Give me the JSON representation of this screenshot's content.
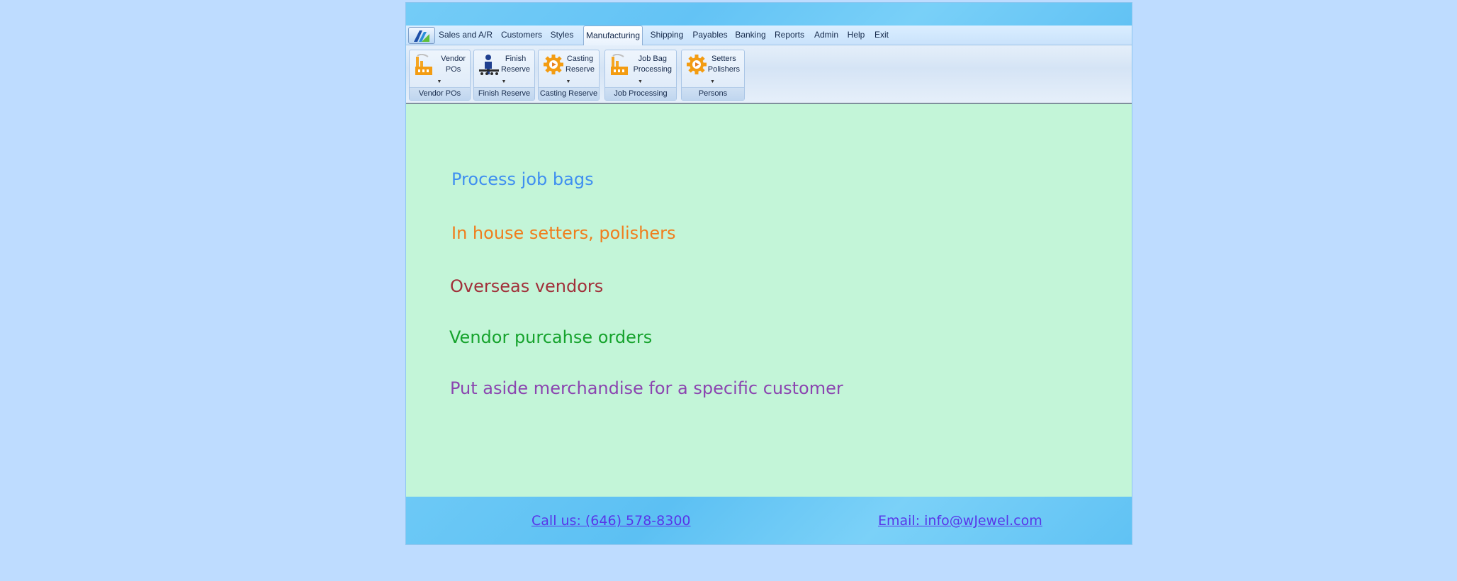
{
  "tabs": [
    {
      "label": "Sales and A/R"
    },
    {
      "label": "Customers"
    },
    {
      "label": "Styles"
    },
    {
      "label": "Manufacturing",
      "active": true
    },
    {
      "label": "Shipping"
    },
    {
      "label": "Payables"
    },
    {
      "label": "Banking"
    },
    {
      "label": "Reports"
    },
    {
      "label": "Admin"
    },
    {
      "label": "Help"
    },
    {
      "label": "Exit"
    }
  ],
  "ribbon": {
    "groups": [
      {
        "button_line1": "Vendor",
        "button_line2": "POs",
        "caption": "Vendor POs",
        "icon": "factory-icon"
      },
      {
        "button_line1": "Finish",
        "button_line2": "Reserve",
        "caption": "Finish Reserve",
        "icon": "worker-conveyor-icon"
      },
      {
        "button_line1": "Casting",
        "button_line2": "Reserve",
        "caption": "Casting Reserve",
        "icon": "gear-icon"
      },
      {
        "button_line1": "Job Bag",
        "button_line2": "Processing",
        "caption": "Job Processing",
        "icon": "factory-icon"
      },
      {
        "button_line1": "Setters",
        "button_line2": "Polishers",
        "caption": "Persons",
        "icon": "gear-icon"
      }
    ]
  },
  "features": [
    {
      "text": "Process job bags",
      "color": "#3f8ff0"
    },
    {
      "text": "In house setters, polishers",
      "color": "#f07d1c"
    },
    {
      "text": "Overseas vendors",
      "color": "#a1303a"
    },
    {
      "text": "Vendor purcahse orders",
      "color": "#16a32d"
    },
    {
      "text": "Put aside merchandise for a specific customer",
      "color": "#8b45b0"
    }
  ],
  "footer": {
    "phone": "Call us: (646) 578-8300",
    "email": "Email: info@wJewel.com"
  }
}
